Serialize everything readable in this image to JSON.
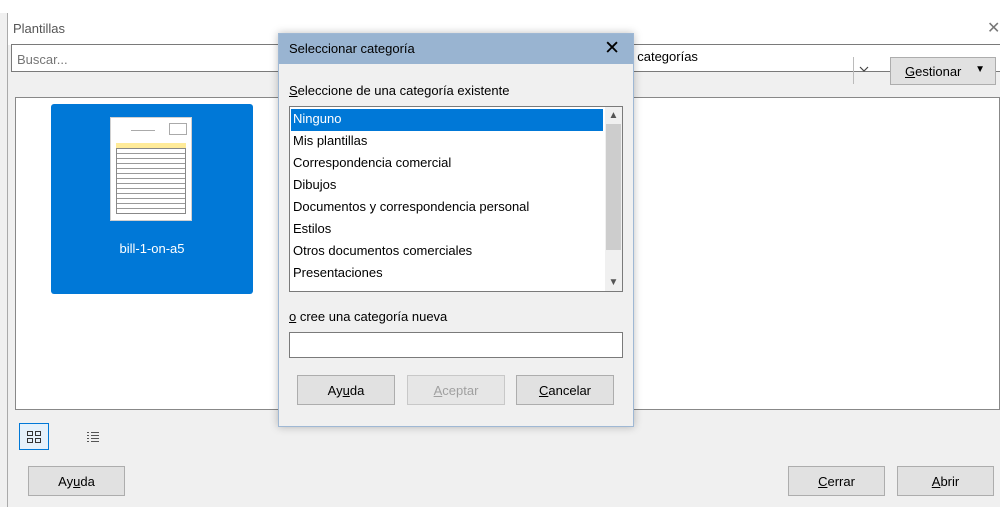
{
  "window": {
    "title": "Plantillas",
    "close_glyph": "✕"
  },
  "toolbar": {
    "search_placeholder": "Buscar...",
    "filter_value": "; categorías",
    "manage_label": "Gestionar",
    "manage_label_mnemonic": "G",
    "manage_label_rest": "estionar"
  },
  "templates": [
    {
      "name": "bill-1-on-a5",
      "selected": true
    }
  ],
  "view_modes": [
    {
      "name": "thumbnail-view",
      "active": true
    },
    {
      "name": "list-view",
      "active": false
    }
  ],
  "footer": {
    "help": {
      "pre": "Ay",
      "mn": "u",
      "post": "da"
    },
    "close": {
      "mn": "C",
      "post": "errar"
    },
    "open": {
      "mn": "A",
      "post": "brir"
    }
  },
  "dialog": {
    "title": "Seleccionar categoría",
    "existing_label": {
      "mn": "S",
      "post": "eleccione de una categoría existente"
    },
    "categories": [
      "Ninguno",
      "Mis plantillas",
      "Correspondencia comercial",
      "Dibujos",
      "Documentos y correspondencia personal",
      "Estilos",
      "Otros documentos comerciales",
      "Presentaciones"
    ],
    "selected_category": "Ninguno",
    "new_label": {
      "mn": "o",
      "post": " cree una categoría nueva"
    },
    "new_value": "",
    "help": {
      "pre": "Ay",
      "mn": "u",
      "post": "da"
    },
    "accept": {
      "mn": "A",
      "post": "ceptar",
      "enabled": false
    },
    "cancel": {
      "mn": "C",
      "post": "ancelar"
    }
  },
  "colors": {
    "accent": "#0078d7",
    "dialog_title_bar": "#99b4d1"
  }
}
